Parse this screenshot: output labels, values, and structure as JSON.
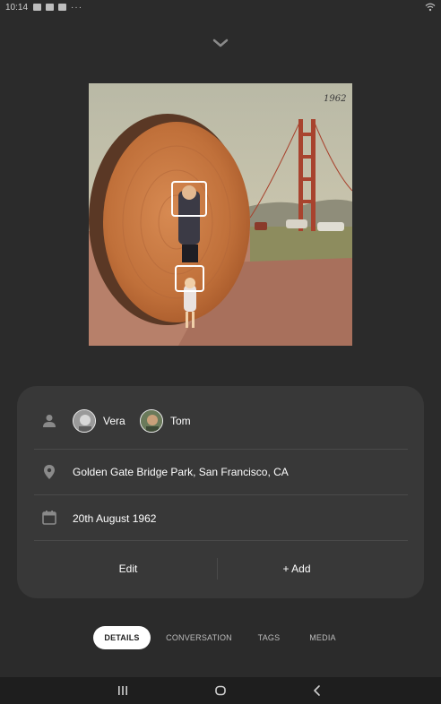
{
  "status_bar": {
    "time": "10:14",
    "notification_icons": [
      "gallery-icon",
      "mail-icon",
      "contact-icon"
    ],
    "more": "···",
    "right_icons": [
      "wifi-icon"
    ]
  },
  "header": {
    "collapse_icon": "chevron-down-icon"
  },
  "photo": {
    "description_icon": "photo",
    "year_caption": "1962",
    "face_boxes": 2
  },
  "details": {
    "people_icon": "person-icon",
    "people": [
      {
        "name": "Vera"
      },
      {
        "name": "Tom"
      }
    ],
    "location_icon": "location-pin-icon",
    "location": "Golden Gate Bridge Park, San Francisco, CA",
    "date_icon": "calendar-icon",
    "date": "20th August 1962",
    "edit_label": "Edit",
    "add_label": "+ Add"
  },
  "tabs": [
    {
      "label": "DETAILS",
      "active": true
    },
    {
      "label": "CONVERSATION",
      "active": false
    },
    {
      "label": "TAGS",
      "active": false
    },
    {
      "label": "MEDIA",
      "active": false
    }
  ],
  "nav_bar": {
    "recents_icon": "recents-icon",
    "home_icon": "home-icon",
    "back_icon": "back-icon"
  },
  "colors": {
    "background": "#2b2b2b",
    "card": "#383838",
    "divider": "#4a4a4a",
    "active_tab_bg": "#ffffff",
    "nav_bar": "#1e1e1e"
  }
}
